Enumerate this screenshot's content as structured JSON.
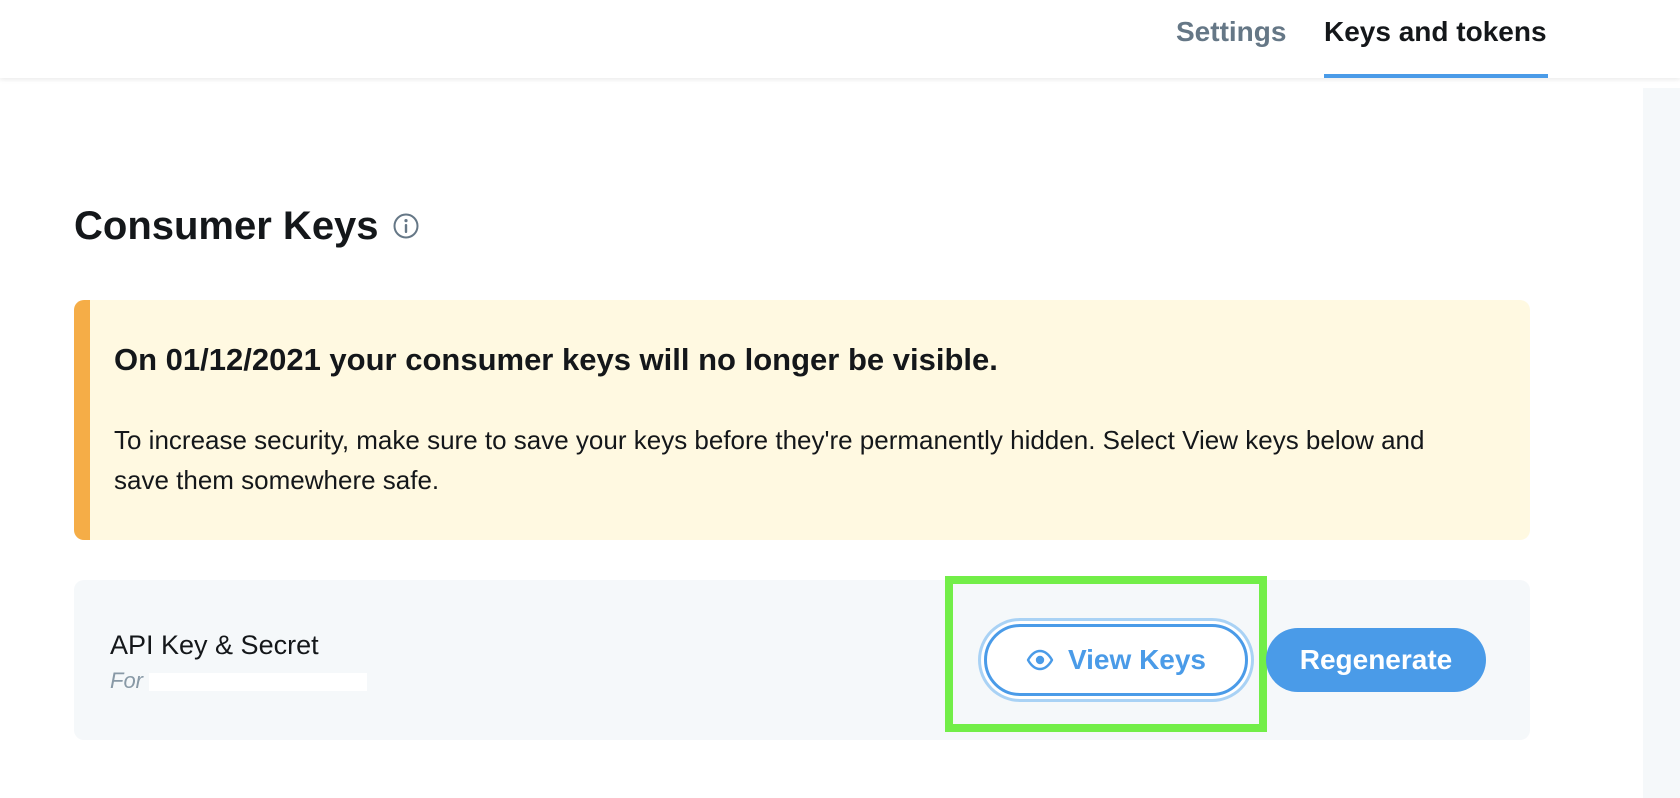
{
  "nav": {
    "tabs": [
      {
        "label": "Settings",
        "active": false
      },
      {
        "label": "Keys and tokens",
        "active": true
      }
    ]
  },
  "section": {
    "title": "Consumer Keys",
    "info_icon": "info-circle-icon"
  },
  "banner": {
    "title": "On 01/12/2021 your consumer keys will no longer be visible.",
    "body": "To increase security, make sure to save your keys before they're permanently hidden. Select View keys below and save them somewhere safe.",
    "accent_color": "#f5ad47",
    "background_color": "#fff9e1"
  },
  "api_key": {
    "label": "API Key & Secret",
    "subtitle_prefix": "For",
    "view_button": "View Keys",
    "view_icon": "eye-icon",
    "regenerate_button": "Regenerate"
  },
  "colors": {
    "accent": "#4a9be8",
    "highlight": "#72ee48"
  }
}
